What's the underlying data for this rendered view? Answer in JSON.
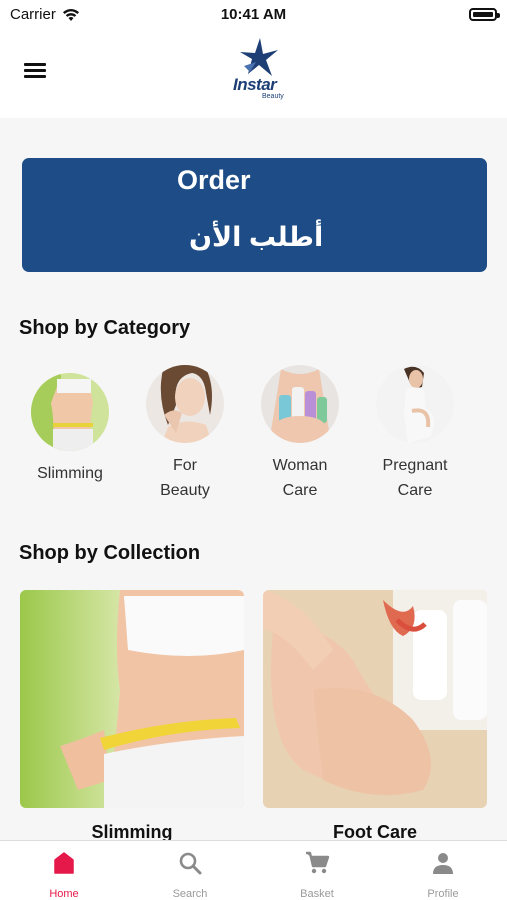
{
  "status_bar": {
    "carrier": "Carrier",
    "time": "10:41 AM"
  },
  "header": {
    "logo_text": "Instar",
    "logo_subtext": "Beauty"
  },
  "order_banner": {
    "label_en": "Order",
    "label_ar": "أطلب الأن"
  },
  "categories_section": {
    "title": "Shop by Category",
    "items": [
      {
        "line1": "Slimming",
        "line2": ""
      },
      {
        "line1": "For",
        "line2": "Beauty"
      },
      {
        "line1": "Woman",
        "line2": "Care"
      },
      {
        "line1": "Pregnant",
        "line2": "Care"
      }
    ]
  },
  "collections_section": {
    "title": "Shop by Collection",
    "items": [
      {
        "title": "Slimming"
      },
      {
        "title": "Foot Care"
      }
    ]
  },
  "tab_bar": {
    "active_color": "#e5194a",
    "items": [
      {
        "label": "Home",
        "icon": "home-icon"
      },
      {
        "label": "Search",
        "icon": "search-icon"
      },
      {
        "label": "Basket",
        "icon": "cart-icon"
      },
      {
        "label": "Profile",
        "icon": "person-icon"
      }
    ]
  }
}
